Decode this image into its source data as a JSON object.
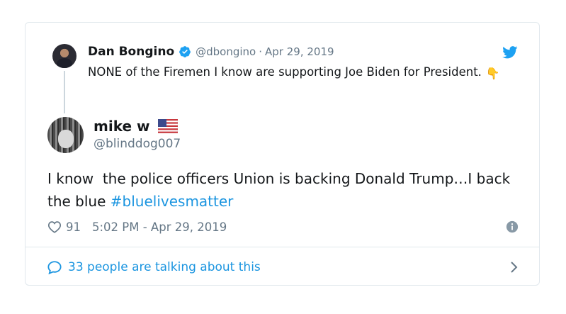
{
  "quoted_tweet": {
    "author_name": "Dan Bongino",
    "handle": "@dbongino",
    "separator": "·",
    "date": "Apr 29, 2019",
    "text": "NONE of the Firemen I know are supporting Joe Biden for President.",
    "emoji": "👇"
  },
  "tweet": {
    "author_name": "mike w",
    "handle": "@blinddog007",
    "text": "I know  the police officers Union is backing Donald Trump…I back the blue ",
    "hashtag": "#bluelivesmatter",
    "like_count": "91",
    "timestamp": "5:02 PM - Apr 29, 2019"
  },
  "conversation": {
    "label": "33 people are talking about this"
  },
  "colors": {
    "twitter_blue": "#1b95e0",
    "secondary_text": "#657786",
    "border": "#e1e8ed"
  },
  "icons": {
    "verified": "verified-badge-icon",
    "bird": "twitter-bird-icon",
    "flag": "us-flag-icon",
    "heart": "heart-icon",
    "info": "info-icon",
    "bubble": "speech-bubble-icon",
    "chevron": "chevron-right-icon"
  }
}
